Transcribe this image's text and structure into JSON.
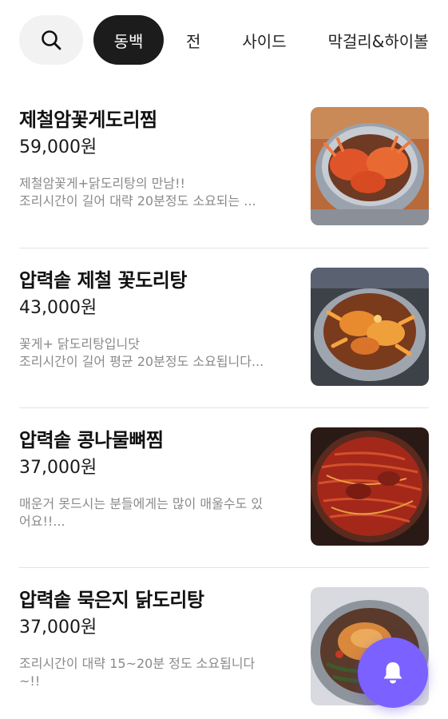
{
  "categories": {
    "active": "동백",
    "items": [
      "전",
      "사이드",
      "막걸리&하이볼"
    ]
  },
  "menu": [
    {
      "name": "제철암꽃게도리찜",
      "price": "59,000원",
      "desc_line1": "제철암꽃게+닭도리탕의 만남!!",
      "desc_line2": "조리시간이 길어 대략 20분정도 소요되는 ..."
    },
    {
      "name": "압력솥 제철 꽃도리탕",
      "price": "43,000원",
      "desc_line1": "꽃게+ 닭도리탕입니닷",
      "desc_line2": "조리시간이 길어 평균 20분정도 소요됩니다..."
    },
    {
      "name": "압력솥 콩나물뼈찜",
      "price": "37,000원",
      "desc_line1": "매운거 못드시는 분들에게는 많이 매울수도 있",
      "desc_line2": "어요!!..."
    },
    {
      "name": "압력솥 묵은지 닭도리탕",
      "price": "37,000원",
      "desc_line1": "조리시간이 대략 15~20분 정도 소요됩니다",
      "desc_line2": "~!!"
    }
  ],
  "icons": {
    "search": "search-icon",
    "fab": "bell-icon"
  },
  "colors": {
    "active_chip": "#1c1c1c",
    "fab": "#7b61ff",
    "desc_text": "#8a8a8a"
  }
}
